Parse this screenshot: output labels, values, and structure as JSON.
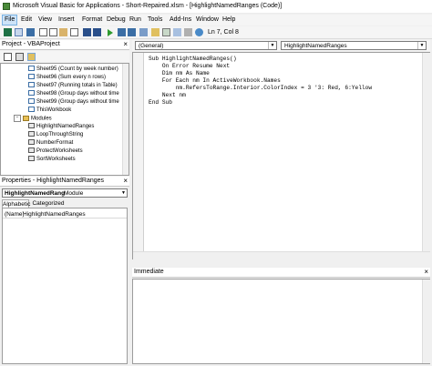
{
  "window": {
    "title": "Microsoft Visual Basic for Applications - Short-Repaired.xlsm - [HighlightNamedRanges (Code)]"
  },
  "menu": [
    "File",
    "Edit",
    "View",
    "Insert",
    "Format",
    "Debug",
    "Run",
    "Tools",
    "Add-Ins",
    "Window",
    "Help"
  ],
  "toolbar": {
    "cursor_pos": "Ln 7, Col 8"
  },
  "project": {
    "title": "Project - VBAProject",
    "items": [
      {
        "label": "Sheet95 (Count by week number)",
        "kind": "sheet"
      },
      {
        "label": "Sheet96 (Sum every n rows)",
        "kind": "sheet"
      },
      {
        "label": "Sheet97 (Running totals in Table)",
        "kind": "sheet"
      },
      {
        "label": "Sheet98 (Group days without time",
        "kind": "sheet"
      },
      {
        "label": "Sheet99 (Group days without time",
        "kind": "sheet"
      },
      {
        "label": "ThisWorkbook",
        "kind": "sheet"
      },
      {
        "label": "Modules",
        "kind": "folder"
      },
      {
        "label": "HighlightNamedRanges",
        "kind": "module"
      },
      {
        "label": "LoopThroughString",
        "kind": "module"
      },
      {
        "label": "NumberFormat",
        "kind": "module"
      },
      {
        "label": "ProtectWorksheets",
        "kind": "module"
      },
      {
        "label": "SortWorksheets",
        "kind": "module"
      }
    ]
  },
  "properties": {
    "title": "Properties - HighlightNamedRanges",
    "object_name": "HighlightNamedRang",
    "object_type": "Module",
    "tabs": [
      "Alphabetic",
      "Categorized"
    ],
    "rows": [
      {
        "name": "(Name)",
        "value": "HighlightNamedRanges"
      }
    ]
  },
  "code": {
    "object_combo": "(General)",
    "proc_combo": "HighlightNamedRanges",
    "lines": [
      "Sub HighlightNamedRanges()",
      "    On Error Resume Next",
      "    Dim nm As Name",
      "    For Each nm In ActiveWorkbook.Names",
      "        nm.RefersToRange.Interior.ColorIndex = 3 '3: Red, 6:Yellow",
      "    Next nm",
      "End Sub"
    ]
  },
  "immediate": {
    "title": "Immediate"
  }
}
